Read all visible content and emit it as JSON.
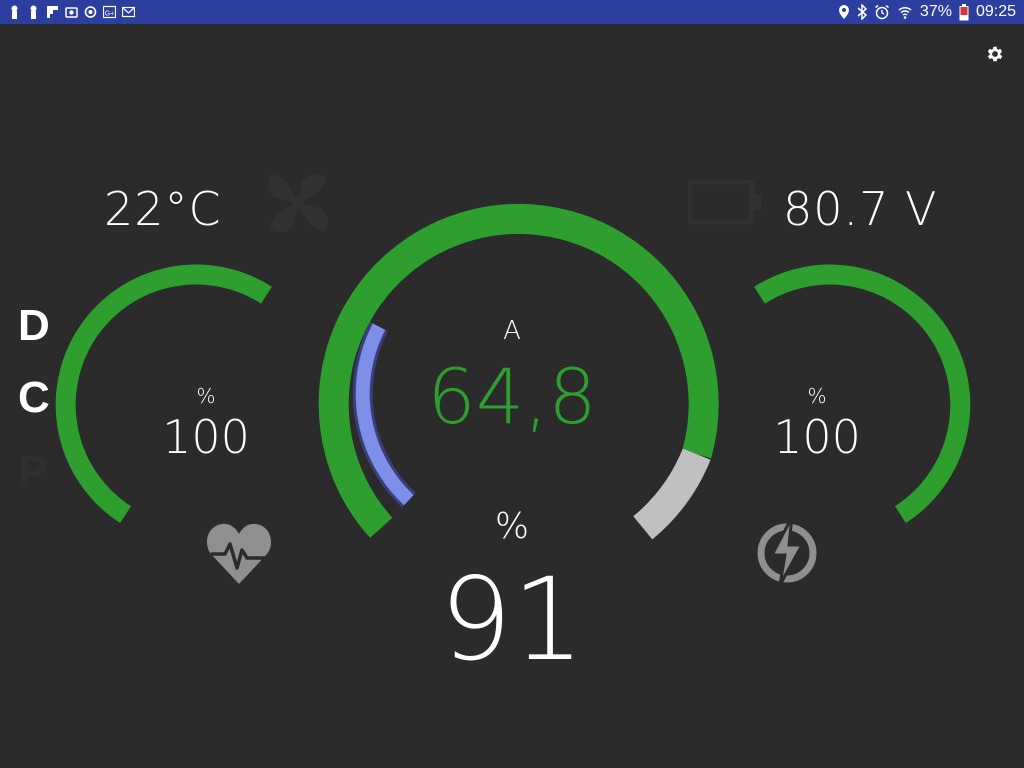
{
  "status_bar": {
    "battery_percent": "37%",
    "time": "09:25",
    "background_color": "#2c3e9e",
    "left_icons": [
      "person-icon",
      "person-icon",
      "flipboard-icon",
      "camera-icon",
      "sync-icon",
      "google-plus-icon",
      "gmail-icon"
    ],
    "right_icons": [
      "location-icon",
      "bluetooth-icon",
      "alarm-icon",
      "wifi-icon",
      "battery-icon"
    ]
  },
  "settings": {
    "icon": "settings-gear-icon"
  },
  "gear_selector": {
    "d": "D",
    "c": "C",
    "p": "P",
    "active": "D"
  },
  "temperature": {
    "value": "22°C"
  },
  "voltage": {
    "value": "80.7 V"
  },
  "left_gauge": {
    "unit": "%",
    "value": "100",
    "fill_percent": 100,
    "icon": "heart-health-icon"
  },
  "right_gauge": {
    "unit": "%",
    "value": "100",
    "fill_percent": 100,
    "icon": "charging-bolt-icon"
  },
  "center_gauge": {
    "current_unit": "A",
    "current_value": "64,8",
    "soc_unit": "%",
    "soc_value": "91",
    "soc_fill_percent": 91,
    "current_colors": {
      "main": "#2e9e2e",
      "regen": "#7d8fe8",
      "reserve": "#c0c0c0"
    }
  },
  "colors": {
    "accent_green": "#2e9e2e",
    "background": "#2b2b2c",
    "regen_blue": "#7d8fe8",
    "inactive": "#c0c0c0"
  }
}
